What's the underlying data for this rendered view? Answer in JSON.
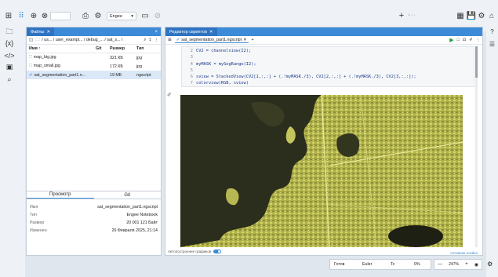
{
  "toolbar": {
    "branch": "Engee",
    "counter": "",
    "plus": "+",
    "extra": "× ‹ ›"
  },
  "files": {
    "tab_label": "Файлы",
    "breadcrumb": "/ us... / user_exampl... / debug_... / sat_s... /",
    "headers": {
      "name": "Имя ↑",
      "git": "Git",
      "size": "Размер",
      "type": "Тип"
    },
    "rows": [
      {
        "name": "map_big.jpg",
        "git": "",
        "size": "321 КБ",
        "type": "jpg"
      },
      {
        "name": "map_small.jpg",
        "git": "",
        "size": "172 КБ",
        "type": "jpg"
      },
      {
        "name": "sat_segmentation_part1.n...",
        "git": "",
        "size": "19 МБ",
        "type": "ngscript"
      }
    ],
    "info_tabs": [
      "Просмотр",
      "Git"
    ],
    "info": [
      {
        "k": "Имя",
        "v": "sat_segmentation_part1.ngscript"
      },
      {
        "k": "Тип",
        "v": "Engee Notebook"
      },
      {
        "k": "Размер",
        "v": "20 001 121 Байт"
      },
      {
        "k": "Изменен",
        "v": "26 Февраля 2025, 21:14"
      }
    ]
  },
  "editor": {
    "tab_label": "Редактор скриптов",
    "file_tab": "sat_segmentation_part1.ngscript",
    "code_lines": [
      {
        "n": "2",
        "t": "CV2 = channelview(I2);"
      },
      {
        "n": "3",
        "t": ""
      },
      {
        "n": "4",
        "t": "myMASK = mySegRange(I2);"
      },
      {
        "n": "5",
        "t": ""
      },
      {
        "n": "6",
        "t": "sview = StackedView(CV2[1,:,:] + (.!myMASK./3), CV2[2,:,:] + (.!myMASK./3), CV2[3,:,:]);"
      },
      {
        "n": "7",
        "t": "colorview(RGB, sview)"
      }
    ],
    "autoplot_label": "Автопостроение графиков",
    "active_label": "Активная ячейка"
  },
  "status": {
    "state": "Готов",
    "solver": "Euler",
    "tc": "Tc",
    "progress": "0%",
    "zoom": "247%"
  },
  "colors": {
    "accent": "#3d8bd8",
    "tab": "#2f74c2",
    "run": "#1a9c3a"
  }
}
